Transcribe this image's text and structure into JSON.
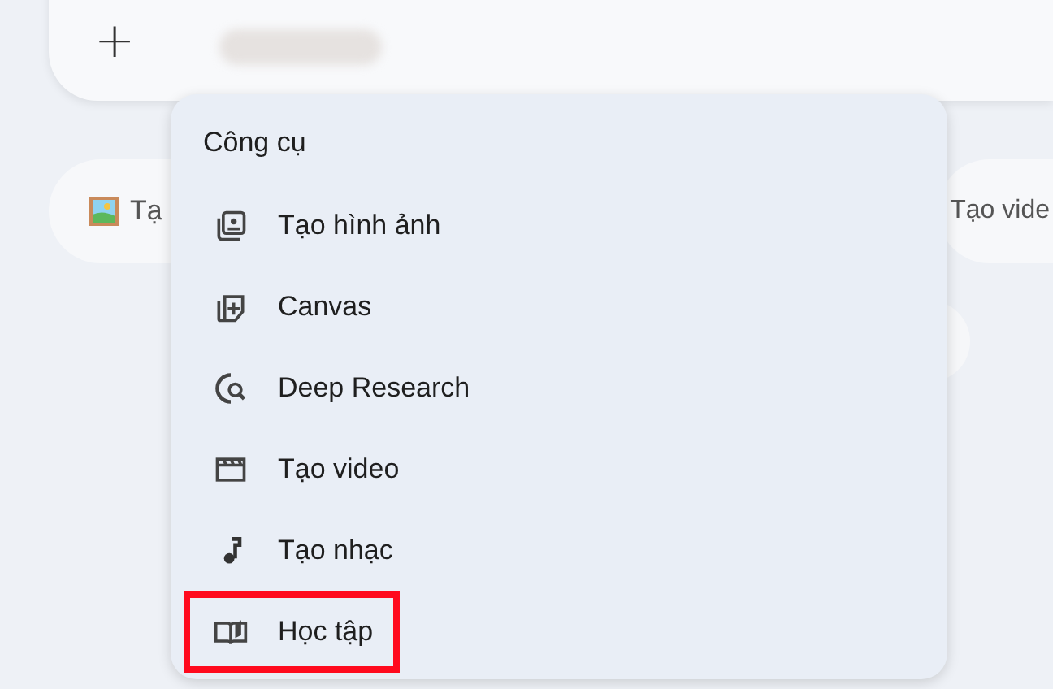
{
  "composer": {
    "add_button": "+"
  },
  "chips": [
    {
      "kind": "image",
      "label": "Tạ"
    },
    {
      "kind": "plain",
      "label": "Tạo vide"
    }
  ],
  "tools_menu": {
    "title": "Công cụ",
    "items": [
      {
        "kind": "image",
        "label": "Tạo hình ảnh",
        "highlighted": false
      },
      {
        "kind": "canvas",
        "label": "Canvas",
        "highlighted": false
      },
      {
        "kind": "research",
        "label": "Deep Research",
        "highlighted": false
      },
      {
        "kind": "video",
        "label": "Tạo video",
        "highlighted": false
      },
      {
        "kind": "music",
        "label": "Tạo nhạc",
        "highlighted": false
      },
      {
        "kind": "book",
        "label": "Học tập",
        "highlighted": true
      }
    ]
  }
}
